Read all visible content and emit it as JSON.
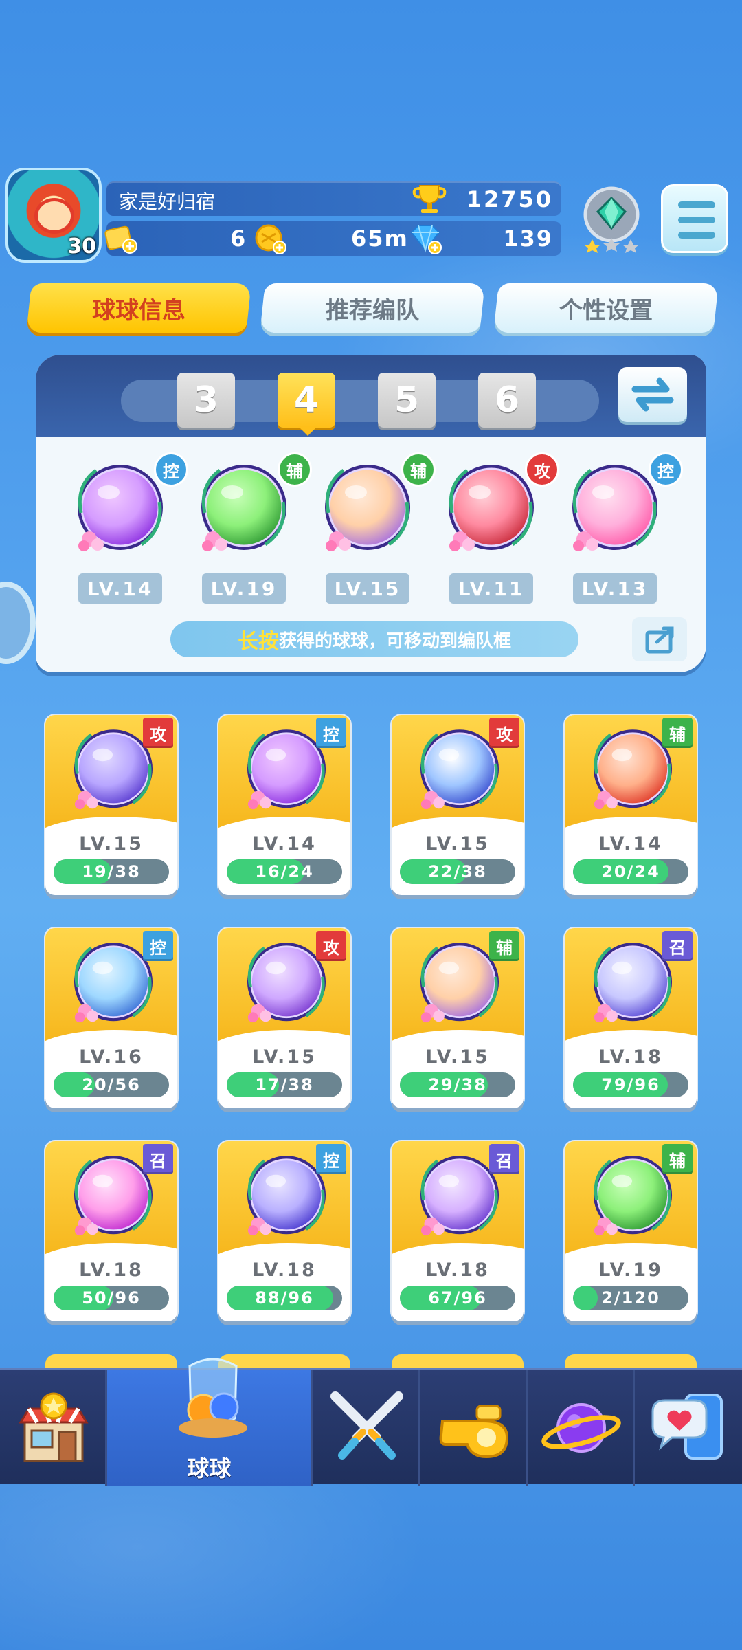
{
  "player": {
    "name": "家是好归宿",
    "level": "30",
    "trophies": "12750",
    "tickets": "6",
    "coins": "65m",
    "gems": "139"
  },
  "tabs": [
    {
      "label": "球球信息",
      "active": true
    },
    {
      "label": "推荐编队",
      "active": false
    },
    {
      "label": "个性设置",
      "active": false
    }
  ],
  "team": {
    "slots": [
      "3",
      "4",
      "5",
      "6"
    ],
    "active_slot": "4",
    "members": [
      {
        "role": "控",
        "level": "LV.14",
        "icon": "butterfly-ball-icon"
      },
      {
        "role": "辅",
        "level": "LV.19",
        "icon": "green-arrow-ball-icon"
      },
      {
        "role": "辅",
        "level": "LV.15",
        "icon": "shadow-figures-ball-icon"
      },
      {
        "role": "攻",
        "level": "LV.11",
        "icon": "red-dinosaur-ball-icon"
      },
      {
        "role": "控",
        "level": "LV.13",
        "icon": "heart-ball-icon"
      }
    ],
    "hint_highlight": "长按",
    "hint_text": "获得的球球，可移动到编队框"
  },
  "collection": [
    {
      "role": "攻",
      "level": "LV.15",
      "progress": "19/38",
      "fill": 0.5,
      "icon": "sword-ball-icon"
    },
    {
      "role": "控",
      "level": "LV.14",
      "progress": "16/24",
      "fill": 0.67,
      "icon": "butterfly-ball-icon"
    },
    {
      "role": "攻",
      "level": "LV.15",
      "progress": "22/38",
      "fill": 0.58,
      "icon": "light-orb-ball-icon"
    },
    {
      "role": "辅",
      "level": "LV.14",
      "progress": "20/24",
      "fill": 0.83,
      "icon": "wings-ball-icon"
    },
    {
      "role": "控",
      "level": "LV.16",
      "progress": "20/56",
      "fill": 0.36,
      "icon": "cloud-wave-ball-icon"
    },
    {
      "role": "攻",
      "level": "LV.15",
      "progress": "17/38",
      "fill": 0.45,
      "icon": "pixel-block-ball-icon"
    },
    {
      "role": "辅",
      "level": "LV.15",
      "progress": "29/38",
      "fill": 0.76,
      "icon": "shadow-figures-ball-icon"
    },
    {
      "role": "召",
      "level": "LV.18",
      "progress": "79/96",
      "fill": 0.82,
      "icon": "spiral-ball-icon"
    },
    {
      "role": "召",
      "level": "LV.18",
      "progress": "50/96",
      "fill": 0.52,
      "icon": "mushroom-ball-icon"
    },
    {
      "role": "控",
      "level": "LV.18",
      "progress": "88/96",
      "fill": 0.92,
      "icon": "eye-ball-icon"
    },
    {
      "role": "召",
      "level": "LV.18",
      "progress": "67/96",
      "fill": 0.7,
      "icon": "ghost-ball-icon"
    },
    {
      "role": "辅",
      "level": "LV.19",
      "progress": "2/120",
      "fill": 0.02,
      "icon": "green-arrow-ball-icon"
    }
  ],
  "nav": [
    {
      "id": "shop",
      "label": "",
      "icon": "shop-icon"
    },
    {
      "id": "balls",
      "label": "球球",
      "icon": "balls-icon",
      "active": true
    },
    {
      "id": "battle",
      "label": "",
      "icon": "crossed-swords-icon"
    },
    {
      "id": "whistle",
      "label": "",
      "icon": "whistle-icon"
    },
    {
      "id": "planet",
      "label": "",
      "icon": "planet-icon"
    },
    {
      "id": "social",
      "label": "",
      "icon": "chat-heart-icon"
    }
  ],
  "colors": {
    "role_attack": "#e23b3b",
    "role_control": "#3da1e0",
    "role_support": "#3db34a",
    "role_summon": "#6a5ad6",
    "progress_fill": "#3ecf79"
  }
}
